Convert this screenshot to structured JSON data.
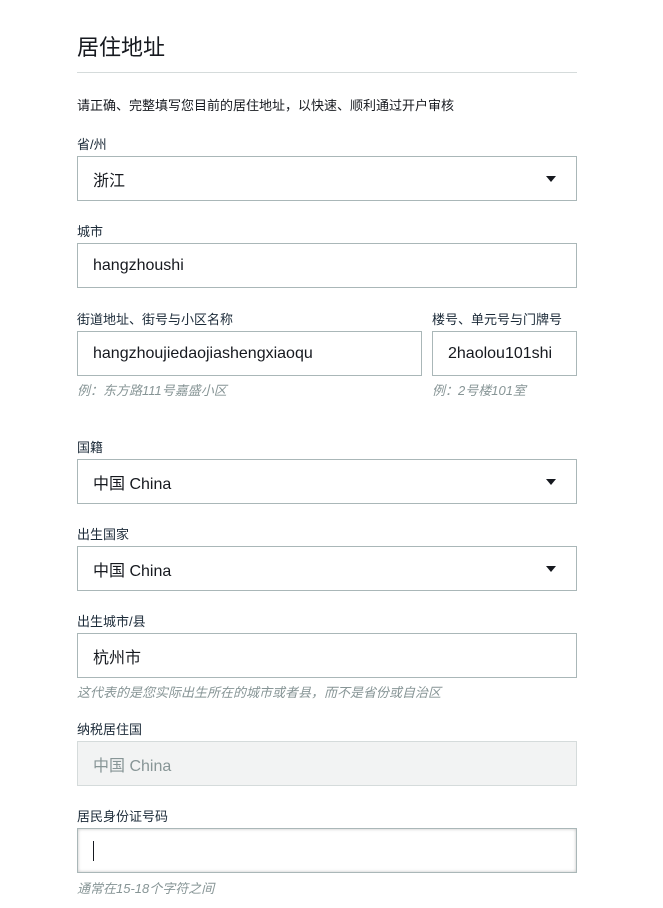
{
  "section": {
    "title": "居住地址",
    "intro": "请正确、完整填写您目前的居住地址，以快速、顺利通过开户审核"
  },
  "fields": {
    "province": {
      "label": "省/州",
      "value": "浙江",
      "icon": "chevron-down-icon"
    },
    "city": {
      "label": "城市",
      "value": "hangzhoushi"
    },
    "street": {
      "label": "街道地址、街号与小区名称",
      "value": "hangzhoujiedaojiashengxiaoqu",
      "hint": "例：东方路111号嘉盛小区"
    },
    "unit": {
      "label": "楼号、单元号与门牌号",
      "value": "2haolou101shi",
      "hint": "例：2号楼101室"
    },
    "nationality": {
      "label": "国籍",
      "value": "中国 China",
      "icon": "chevron-down-icon"
    },
    "birth_country": {
      "label": "出生国家",
      "value": "中国 China",
      "icon": "chevron-down-icon"
    },
    "birth_city": {
      "label": "出生城市/县",
      "value": "杭州市",
      "hint": "这代表的是您实际出生所在的城市或者县，而不是省份或自治区"
    },
    "tax_country": {
      "label": "纳税居住国",
      "value": "中国 China",
      "disabled": true
    },
    "id_number": {
      "label": "居民身份证号码",
      "value": "",
      "hint": "通常在15-18个字符之间"
    }
  }
}
